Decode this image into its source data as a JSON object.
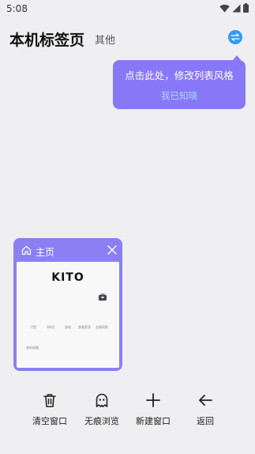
{
  "status_bar": {
    "time": "5:08"
  },
  "header": {
    "title": "本机标签页",
    "other": "其他"
  },
  "tooltip": {
    "text": "点击此处，修改列表风格",
    "dismiss": "我已知晓"
  },
  "tab_card": {
    "title": "主页",
    "preview": {
      "logo": "KITO",
      "shortcuts": [
        "只是",
        "3科目",
        "游戏",
        "查看更多",
        "必备同款"
      ],
      "bookmark": "我的收藏"
    }
  },
  "bottom_bar": {
    "clear": "清空窗口",
    "incognito": "无痕浏览",
    "new_window": "新建窗口",
    "back": "返回"
  },
  "colors": {
    "accent": "#8878f7",
    "card": "#8a80f4",
    "switch": "#2f9bf5",
    "tooltip_link": "#a9d8ff"
  }
}
